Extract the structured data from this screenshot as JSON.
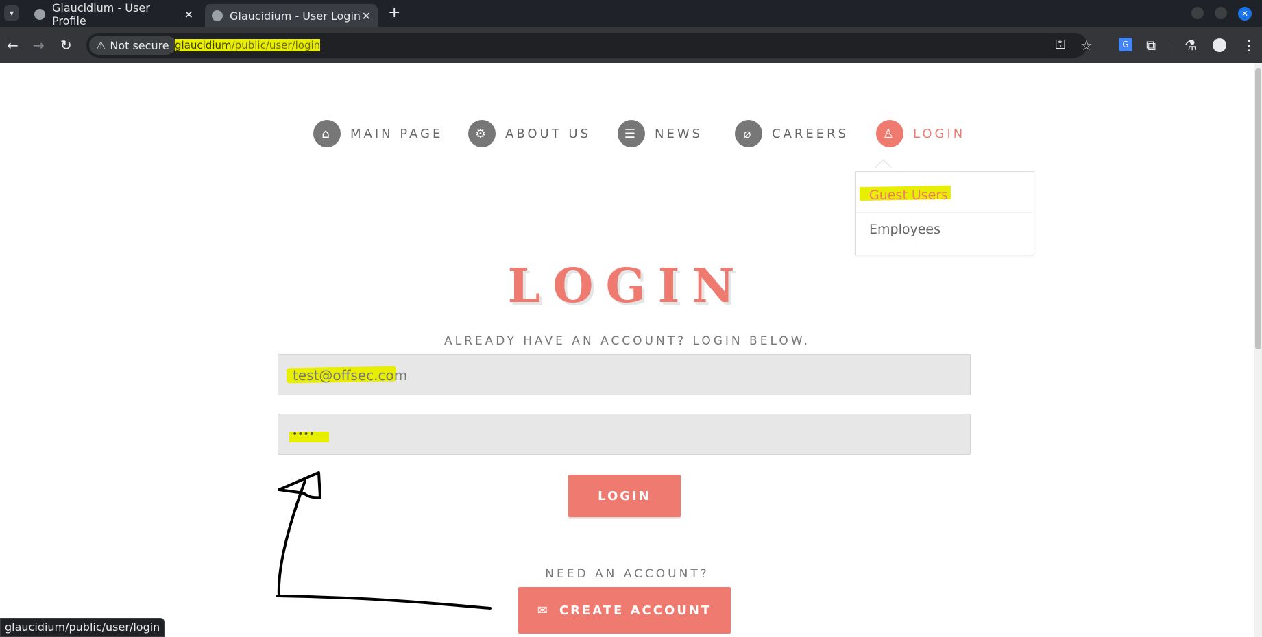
{
  "browser": {
    "tabs": [
      {
        "title": "Glaucidium - User Profile",
        "active": false
      },
      {
        "title": "Glaucidium - User Login",
        "active": true
      }
    ],
    "new_tab_symbol": "+",
    "security_label": "Not secure",
    "url": {
      "host": "glaucidium",
      "path": "/public/user/login"
    },
    "status_url": "glaucidium/public/user/login"
  },
  "nav": {
    "items": [
      {
        "label": "MAIN PAGE",
        "icon": "home-icon"
      },
      {
        "label": "ABOUT US",
        "icon": "gear-icon"
      },
      {
        "label": "NEWS",
        "icon": "newspaper-icon"
      },
      {
        "label": "CAREERS",
        "icon": "paperclip-icon"
      },
      {
        "label": "LOGIN",
        "icon": "user-icon",
        "active": true
      }
    ],
    "dropdown": [
      "Guest Users",
      "Employees"
    ]
  },
  "login": {
    "title": "LOGIN",
    "subtitle": "ALREADY HAVE AN ACCOUNT? LOGIN BELOW.",
    "email_value": "test@offsec.com",
    "password_value": "••••",
    "button_label": "LOGIN",
    "need_account": "NEED AN ACCOUNT?",
    "create_label": "CREATE ACCOUNT"
  },
  "colors": {
    "accent": "#ef7a6f",
    "highlight": "#e8ee00",
    "nav_gray": "#777777"
  }
}
